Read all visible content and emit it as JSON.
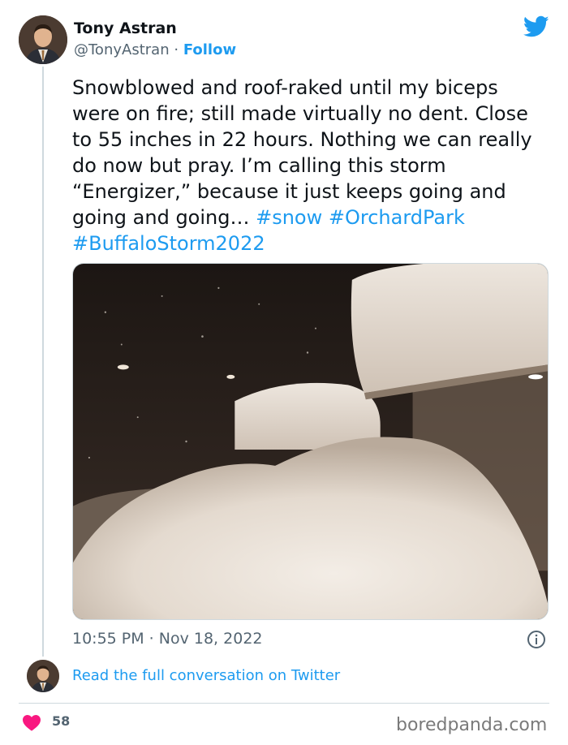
{
  "author": {
    "name": "Tony Astran",
    "handle": "@TonyAstran",
    "separator": "·",
    "follow_label": "Follow",
    "avatar_icon": "profile-photo"
  },
  "brand": {
    "logo_icon": "twitter-bird-icon",
    "color": "#1d9bf0"
  },
  "tweet": {
    "text": "Snowblowed and roof-raked until my biceps were on fire; still made virtually no dent. Close to 55 inches in 22 hours. Nothing we can really do now but pray. I’m calling this storm “Energizer,” because it just keeps going and going and going… ",
    "hashtags": [
      "#snow",
      "#OrchardPark",
      "#BuffaloStorm2022"
    ],
    "photo": "Night photo of deep snow piled outside a window, with snow-covered roof and falling snow",
    "timestamp": "10:55 PM · Nov 18, 2022"
  },
  "footer": {
    "read_more_label": "Read the full conversation on Twitter",
    "like_count": "58",
    "heart_color": "#f91880",
    "watermark": "boredpanda.com"
  }
}
